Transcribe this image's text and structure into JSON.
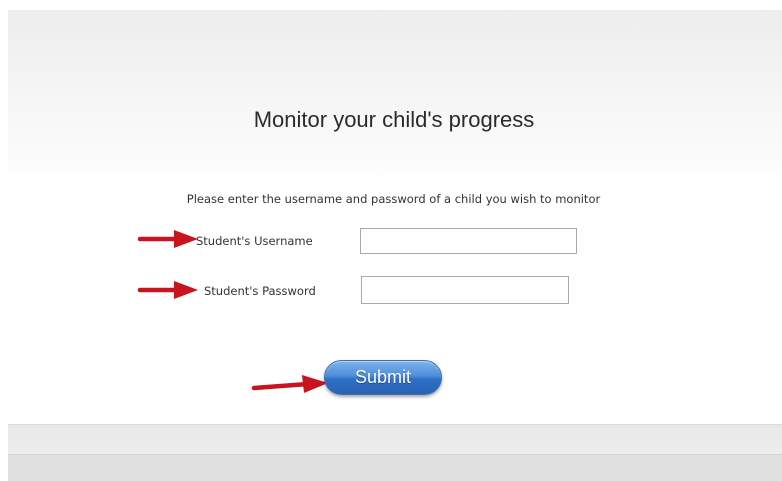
{
  "form": {
    "title": "Monitor your child's progress",
    "instructions": "Please enter the username and password of a child you wish to monitor",
    "username_label": "Student's Username",
    "username_value": "",
    "password_label": "Student's Password",
    "password_value": "",
    "submit_label": "Submit"
  },
  "colors": {
    "annotation_arrow": "#c8141e",
    "submit_button": "#3a7fd4"
  },
  "icons": {
    "annotation": "red-arrow-icon"
  }
}
